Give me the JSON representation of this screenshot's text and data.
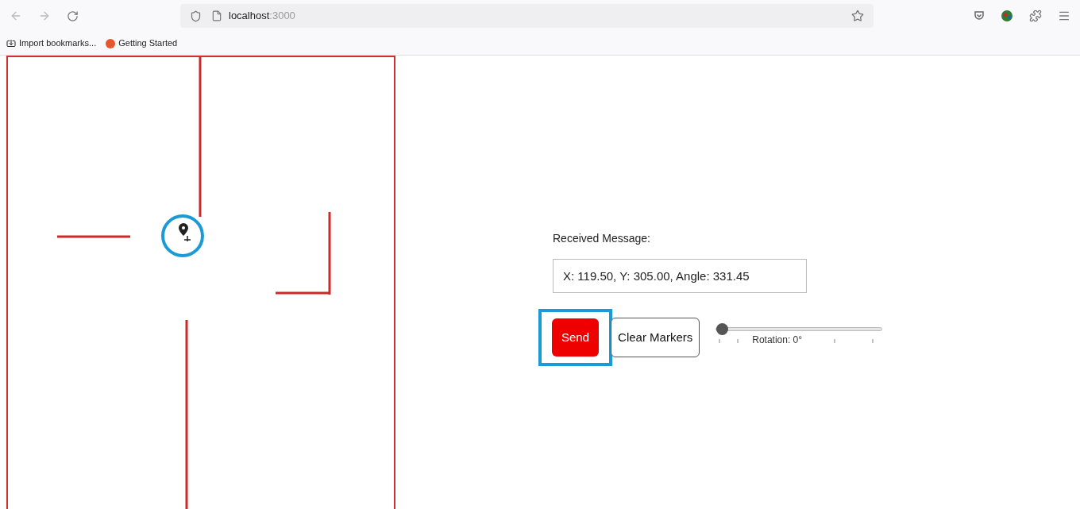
{
  "browser": {
    "address": "localhost",
    "port": ":3000",
    "bookmarks": [
      {
        "label": "Import bookmarks...",
        "kind": "import"
      },
      {
        "label": "Getting Started",
        "kind": "firefox"
      }
    ]
  },
  "panel": {
    "label": "Received Message:",
    "message": "X: 119.50, Y: 305.00, Angle: 331.45"
  },
  "buttons": [
    {
      "label": "Send",
      "kind": "primary",
      "highlighted": true
    },
    {
      "label": "Clear Markers",
      "kind": "outline",
      "highlighted": false
    }
  ],
  "slider": {
    "level": 0,
    "label": "Rotation: 0°"
  }
}
